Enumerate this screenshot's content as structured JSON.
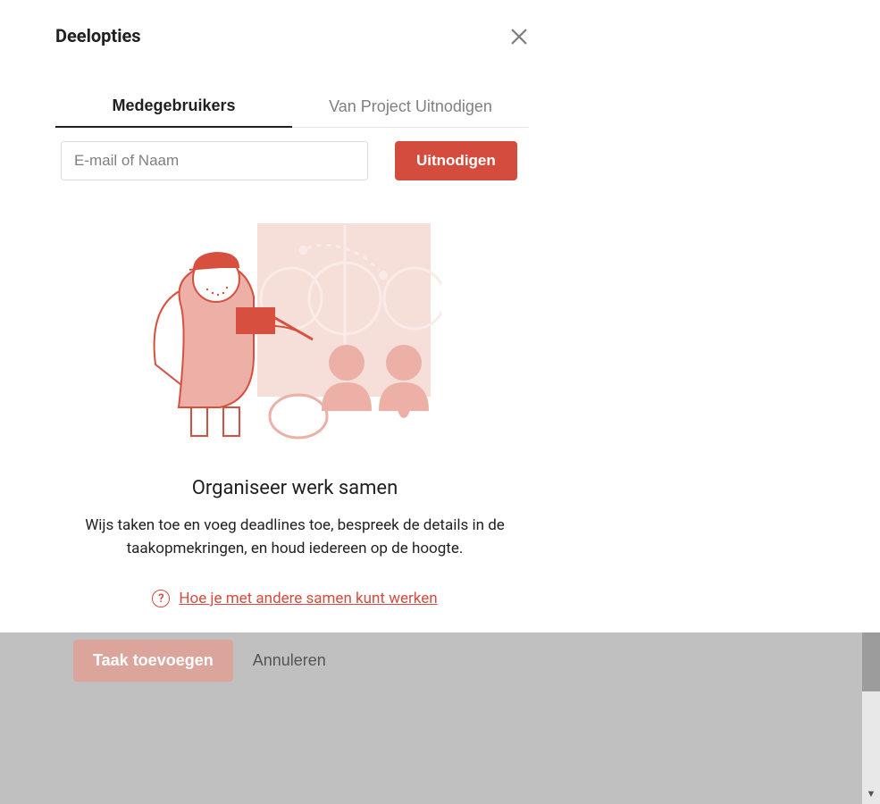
{
  "modal": {
    "title": "Deelopties",
    "tabs": [
      {
        "label": "Medegebruikers",
        "active": true
      },
      {
        "label": "Van Project Uitnodigen",
        "active": false
      }
    ],
    "invite": {
      "placeholder": "E-mail of Naam",
      "button": "Uitnodigen"
    },
    "empty": {
      "title": "Organiseer werk samen",
      "description": "Wijs taken toe en voeg deadlines toe, bespreek de details in de taakopmekringen, en houd iedereen op de hoogte."
    },
    "help": {
      "link": "Hoe je met andere samen kunt werken"
    }
  },
  "behind": {
    "add_task": "Taak toevoegen",
    "cancel": "Annuleren"
  },
  "icons": {
    "close": "close-icon",
    "help": "help-icon"
  },
  "colors": {
    "accent": "#d44c3d"
  }
}
